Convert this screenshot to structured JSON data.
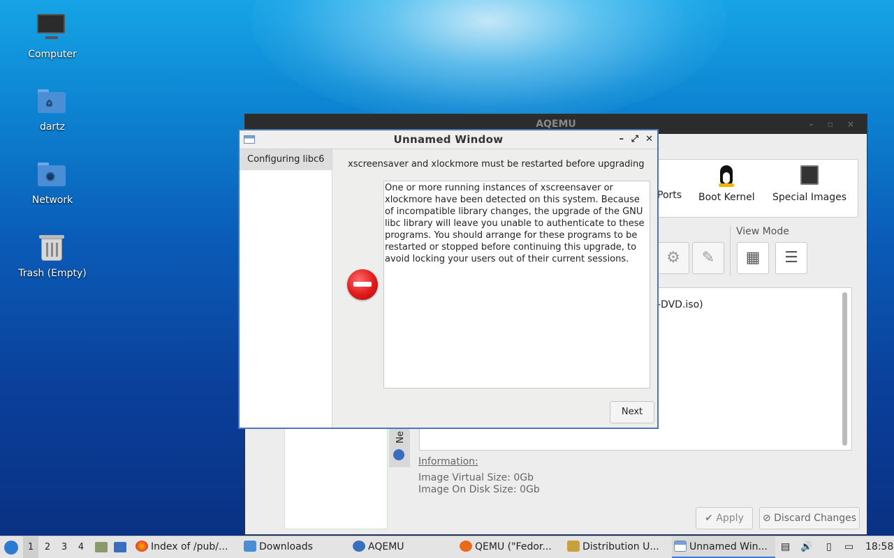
{
  "desktop": {
    "icons": [
      {
        "label": "Computer"
      },
      {
        "label": "dartz"
      },
      {
        "label": "Network"
      },
      {
        "label": "Trash (Empty)"
      }
    ]
  },
  "aqemu": {
    "title": "AQEMU",
    "toolbar": {
      "ports_label": "Ports",
      "boot_kernel_label": "Boot Kernel",
      "special_images_label": "Special Images"
    },
    "view_mode_label": "View Mode",
    "list_text": "-DVD.iso)",
    "vertical_tab_label": "Ne",
    "information": {
      "title": "Information:",
      "virtual_size": "Image Virtual Size: 0Gb",
      "disk_size": "Image On Disk Size: 0Gb"
    },
    "apply_label": "Apply",
    "discard_label": "Discard Changes"
  },
  "dialog": {
    "title": "Unnamed Window",
    "sidebar_item": "Configuring libc6",
    "heading": "xscreensaver and xlockmore must be restarted before upgrading",
    "message": "One or more running instances of xscreensaver or xlockmore have been detected on this system. Because of incompatible library changes, the upgrade of the GNU libc library will leave you unable to authenticate to these programs. You should arrange for these programs to be restarted or stopped before continuing this upgrade, to avoid locking your users out of their current sessions.",
    "next_label": "Next"
  },
  "taskbar": {
    "workspaces": [
      "1",
      "2",
      "3",
      "4"
    ],
    "active_workspace": "1",
    "tasks": [
      {
        "label": "Index of /pub/..."
      },
      {
        "label": "Downloads"
      },
      {
        "label": "AQEMU"
      },
      {
        "label": "QEMU (\"Fedor..."
      },
      {
        "label": "Distribution U..."
      },
      {
        "label": "Unnamed Win..."
      }
    ],
    "clock": "18:58"
  },
  "colors": {
    "accent": "#3a7bd5",
    "stop_red": "#e01a1a",
    "dialog_border": "#4a78b8"
  }
}
